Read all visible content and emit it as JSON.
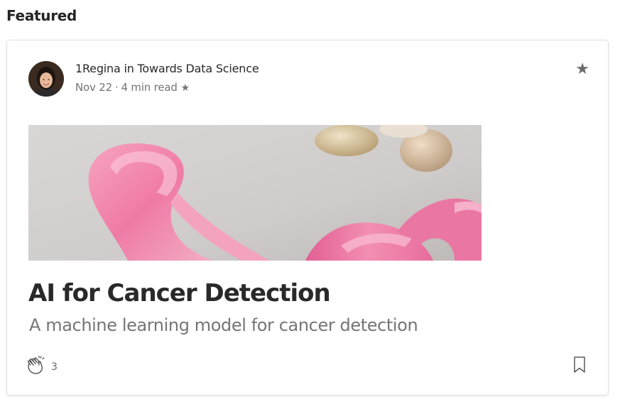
{
  "section": {
    "title": "Featured"
  },
  "post": {
    "author": "1Regina",
    "connector": "in",
    "publication": "Towards Data Science",
    "date": "Nov 22",
    "separator": "·",
    "read_time": "4 min read",
    "member_star": "★",
    "top_star": "★",
    "title": "AI for Cancer Detection",
    "subtitle": "A machine learning model for cancer detection",
    "clap_count": "3"
  },
  "icons": {
    "star": "star-icon",
    "clap": "clap-icon",
    "bookmark": "bookmark-icon"
  },
  "colors": {
    "ribbon": "#f07aa8",
    "text_primary": "#292929",
    "text_secondary": "#757575"
  }
}
